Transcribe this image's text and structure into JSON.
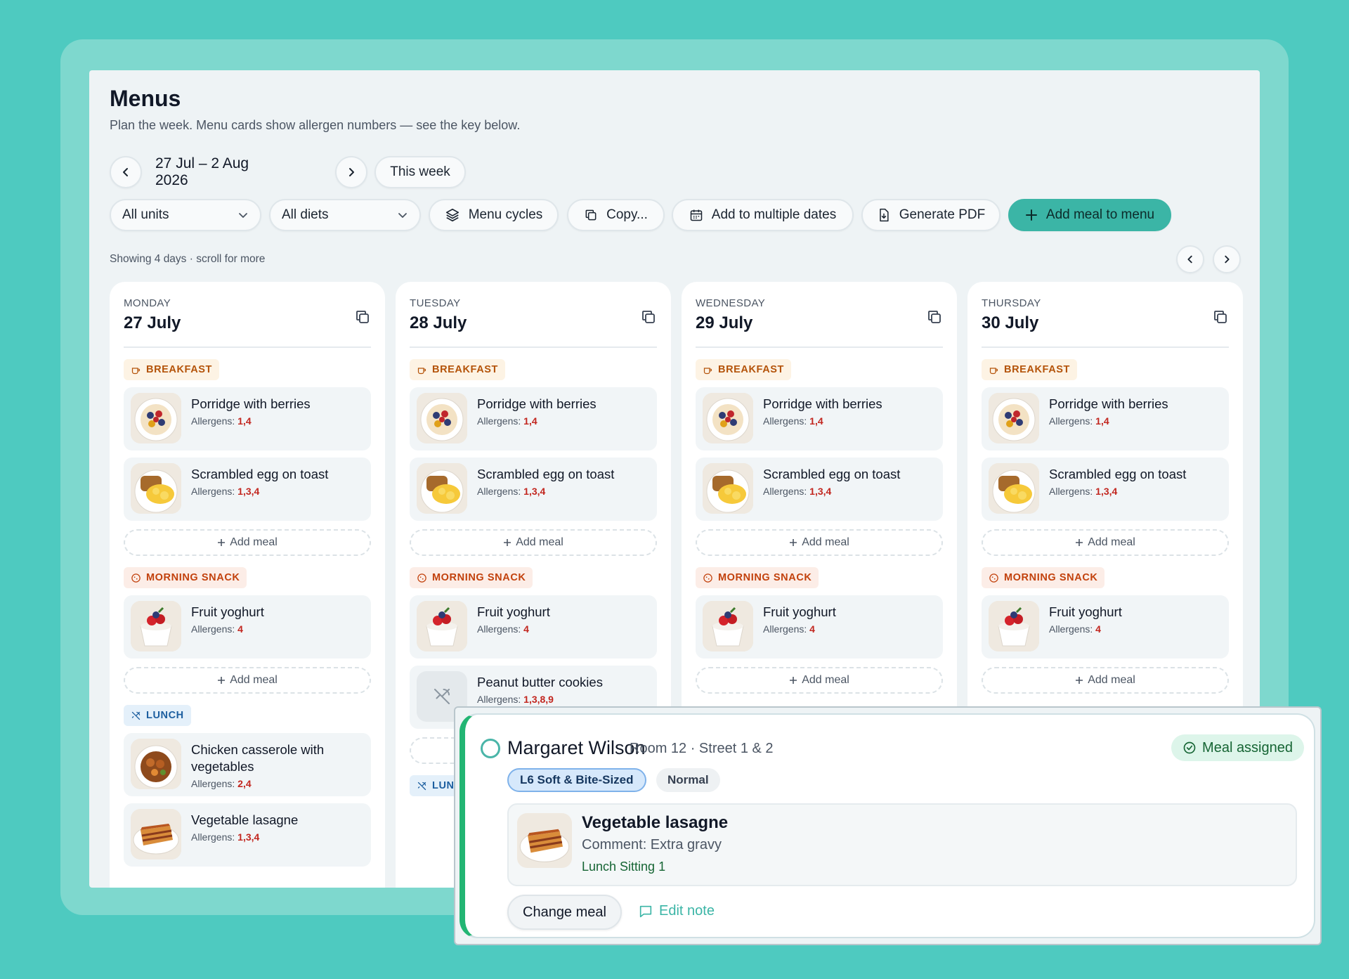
{
  "header": {
    "title": "Menus",
    "subtitle": "Plan the week. Menu cards show allergen numbers — see the key below."
  },
  "toolbar": {
    "date_range": "27 Jul – 2 Aug 2026",
    "this_week": "This week",
    "units_select": "All units",
    "diets_select": "All diets",
    "menu_cycles": "Menu cycles",
    "copy": "Copy...",
    "add_multiple": "Add to multiple dates",
    "generate_pdf": "Generate PDF",
    "add_meal_to_menu": "Add meal to menu"
  },
  "meta": {
    "showing": "Showing 4 days · scroll for more"
  },
  "labels": {
    "allergens_prefix": "Allergens: ",
    "add_meal": "Add meal",
    "breakfast": "BREAKFAST",
    "morning_snack": "MORNING SNACK",
    "lunch": "LUNCH",
    "lunch_cut": "LUN"
  },
  "days": [
    {
      "day": "MONDAY",
      "date": "27 July",
      "breakfast": [
        {
          "name": "Porridge with berries",
          "allergens": "1,4",
          "icon": "porridge"
        },
        {
          "name": "Scrambled egg on toast",
          "allergens": "1,3,4",
          "icon": "egg-toast"
        }
      ],
      "snack": [
        {
          "name": "Fruit yoghurt",
          "allergens": "4",
          "icon": "yoghurt"
        }
      ],
      "lunch": [
        {
          "name": "Chicken casserole with vegetables",
          "allergens": "2,4",
          "icon": "casserole"
        },
        {
          "name": "Vegetable lasagne",
          "allergens": "1,3,4",
          "icon": "lasagne"
        }
      ]
    },
    {
      "day": "TUESDAY",
      "date": "28 July",
      "breakfast": [
        {
          "name": "Porridge with berries",
          "allergens": "1,4",
          "icon": "porridge"
        },
        {
          "name": "Scrambled egg on toast",
          "allergens": "1,3,4",
          "icon": "egg-toast"
        }
      ],
      "snack": [
        {
          "name": "Fruit yoghurt",
          "allergens": "4",
          "icon": "yoghurt"
        },
        {
          "name": "Peanut butter cookies",
          "allergens": "1,3,8,9",
          "icon": "placeholder"
        }
      ]
    },
    {
      "day": "WEDNESDAY",
      "date": "29 July",
      "breakfast": [
        {
          "name": "Porridge with berries",
          "allergens": "1,4",
          "icon": "porridge"
        },
        {
          "name": "Scrambled egg on toast",
          "allergens": "1,3,4",
          "icon": "egg-toast"
        }
      ],
      "snack": [
        {
          "name": "Fruit yoghurt",
          "allergens": "4",
          "icon": "yoghurt"
        }
      ]
    },
    {
      "day": "THURSDAY",
      "date": "30 July",
      "breakfast": [
        {
          "name": "Porridge with berries",
          "allergens": "1,4",
          "icon": "porridge"
        },
        {
          "name": "Scrambled egg on toast",
          "allergens": "1,3,4",
          "icon": "egg-toast"
        }
      ],
      "snack": [
        {
          "name": "Fruit yoghurt",
          "allergens": "4",
          "icon": "yoghurt"
        }
      ]
    }
  ],
  "resident_card": {
    "name": "Margaret Wilson",
    "room": "Room 12 · Street 1 & 2",
    "status": "Meal assigned",
    "diet_tag": "L6 Soft & Bite-Sized",
    "texture_tag": "Normal",
    "meal_name": "Vegetable lasagne",
    "comment": "Comment: Extra gravy",
    "sitting": "Lunch Sitting 1",
    "change_meal": "Change meal",
    "edit_note": "Edit note"
  },
  "colors": {
    "background": "#4ECAC0",
    "accent": "#3BB5A6",
    "allergen_number": "#C2261F",
    "assigned_border": "#22B573"
  }
}
